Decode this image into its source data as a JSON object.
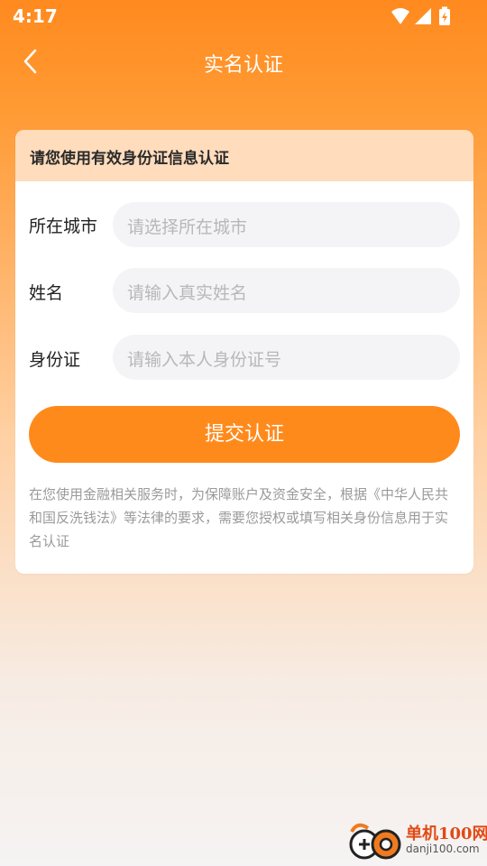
{
  "status_bar": {
    "time": "4:17",
    "icons": [
      "wifi-icon",
      "signal-icon",
      "battery-charging-icon"
    ]
  },
  "nav": {
    "title": "实名认证",
    "back_icon": "chevron-left-icon"
  },
  "card": {
    "header": "请您使用有效身份证信息认证",
    "rows": [
      {
        "label": "所在城市",
        "placeholder": "请选择所在城市"
      },
      {
        "label": "姓名",
        "placeholder": "请输入真实姓名"
      },
      {
        "label": "身份证",
        "placeholder": "请输入本人身份证号"
      }
    ],
    "submit_label": "提交认证",
    "notice": "在您使用金融相关服务时，为保障账户及资金安全，根据《中华人民共和国反洗钱法》等法律的要求，需要您授权或填写相关身份信息用于实名认证"
  },
  "watermark": {
    "name": "单机100网",
    "url": "danji100.com"
  },
  "colors": {
    "accent": "#ff8a1c",
    "header_bg": "#ffdcbc",
    "placeholder": "#b7b7bc"
  }
}
